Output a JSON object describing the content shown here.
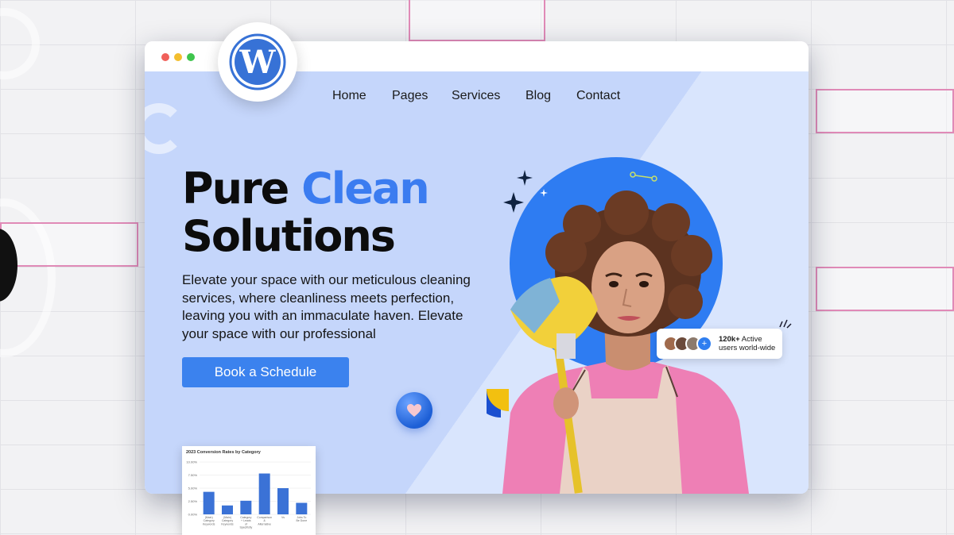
{
  "nav": {
    "items": [
      "Home",
      "Pages",
      "Services",
      "Blog",
      "Contact"
    ]
  },
  "hero": {
    "title_part1": "Pure ",
    "title_accent": "Clean",
    "title_part2": "Solutions",
    "description": "Elevate your space with our meticulous cleaning services, where cleanliness meets perfection, leaving you with an immaculate haven. Elevate your space with our professional",
    "cta_label": "Book a Schedule"
  },
  "users_badge": {
    "count": "120k+",
    "line1_rest": " Active",
    "line2": "users world-wide",
    "plus_icon": "+"
  },
  "colors": {
    "accent": "#3b7cf0",
    "button": "#3b82ee",
    "hero_bg": "#c5d6fb",
    "circle": "#2e7cf2"
  },
  "icons": [
    "wordpress-logo",
    "heart-icon",
    "sparkle-icon",
    "plus-icon"
  ],
  "chart_data": {
    "type": "bar",
    "title": "2023 Conversion Rates by Category",
    "categories": [
      "(Main) Category Keywords",
      "(Main) Category Keywords",
      "Category + Leads of Specificity",
      "Comparison & Alternative",
      "Vs",
      "Jobs To Be Done"
    ],
    "values": [
      4.3,
      1.7,
      2.6,
      7.8,
      5.0,
      2.2
    ],
    "yticks": [
      "10.00%",
      "7.50%",
      "5.00%",
      "2.50%",
      "0.00%"
    ],
    "ylim": [
      0,
      10
    ],
    "xlabel": "",
    "ylabel": ""
  }
}
